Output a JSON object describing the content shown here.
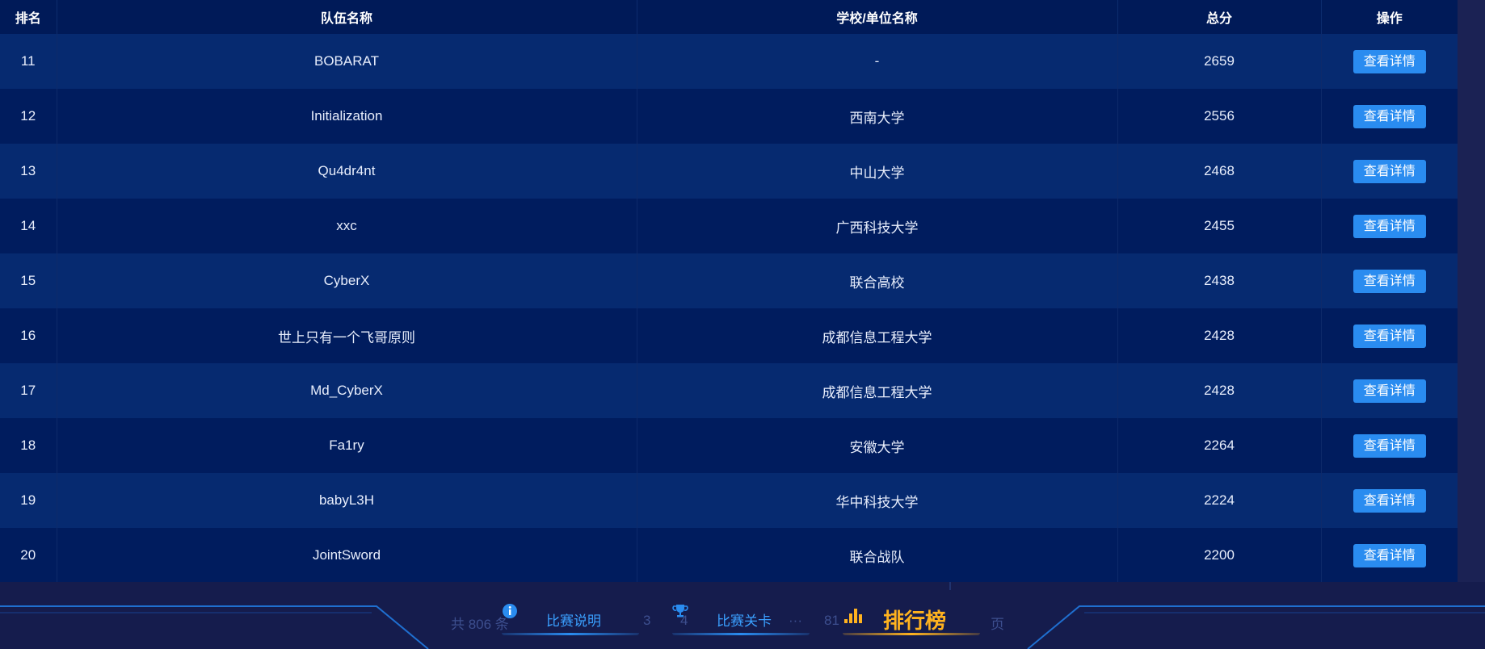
{
  "table": {
    "headers": [
      "排名",
      "队伍名称",
      "学校/单位名称",
      "总分",
      "操作"
    ],
    "rows": [
      {
        "rank": "11",
        "team": "BOBARAT",
        "school": "-",
        "score": "2659",
        "action": "查看详情"
      },
      {
        "rank": "12",
        "team": "Initialization",
        "school": "西南大学",
        "score": "2556",
        "action": "查看详情"
      },
      {
        "rank": "13",
        "team": "Qu4dr4nt",
        "school": "中山大学",
        "score": "2468",
        "action": "查看详情"
      },
      {
        "rank": "14",
        "team": "xxc",
        "school": "广西科技大学",
        "score": "2455",
        "action": "查看详情"
      },
      {
        "rank": "15",
        "team": "CyberX",
        "school": "联合高校",
        "score": "2438",
        "action": "查看详情"
      },
      {
        "rank": "16",
        "team": "世上只有一个飞哥原则",
        "school": "成都信息工程大学",
        "score": "2428",
        "action": "查看详情"
      },
      {
        "rank": "17",
        "team": "Md_CyberX",
        "school": "成都信息工程大学",
        "score": "2428",
        "action": "查看详情"
      },
      {
        "rank": "18",
        "team": "Fa1ry",
        "school": "安徽大学",
        "score": "2264",
        "action": "查看详情"
      },
      {
        "rank": "19",
        "team": "babyL3H",
        "school": "华中科技大学",
        "score": "2224",
        "action": "查看详情"
      },
      {
        "rank": "20",
        "team": "JointSword",
        "school": "联合战队",
        "score": "2200",
        "action": "查看详情"
      }
    ]
  },
  "pager": {
    "total": "共 806 条",
    "page3": "3",
    "page4": "4",
    "ellipsis": "···",
    "page81": "81",
    "suffix": "页"
  },
  "nav": {
    "tabs": [
      {
        "label": "比赛说明",
        "icon": "info-icon"
      },
      {
        "label": "比赛关卡",
        "icon": "trophy-icon"
      },
      {
        "label": "排行榜",
        "icon": "bar-chart-icon",
        "active": true
      }
    ]
  },
  "colors": {
    "accent": "#2a8cf0",
    "active": "#ffb21f",
    "row_dark": "#001c5e",
    "row_light": "#062a70"
  }
}
